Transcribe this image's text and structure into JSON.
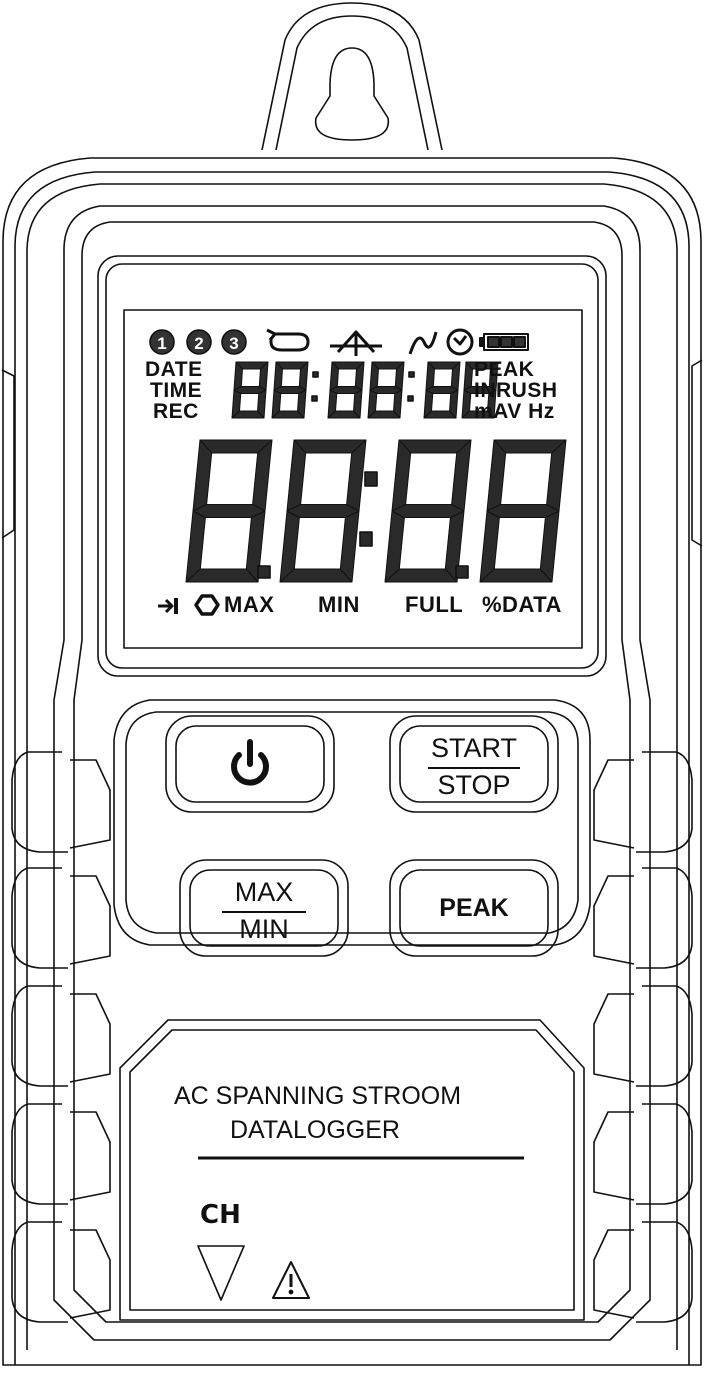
{
  "lcd": {
    "channels": [
      "1",
      "2",
      "3"
    ],
    "left_labels": {
      "date": "DATE",
      "time": "TIME",
      "rec": "REC"
    },
    "right_labels": {
      "peak": "PEAK",
      "inrush": "INRUSH",
      "units": "mAV Hz"
    },
    "small_readout": "88:88:88",
    "main_readout": "8.8:8.8",
    "bottom": {
      "max": "MAX",
      "min": "MIN",
      "full": "FULL",
      "data": "%DATA"
    },
    "icons": [
      "channel-1-icon",
      "channel-2-icon",
      "channel-3-icon",
      "loop-icon",
      "peak-hold-icon",
      "sine-wave-icon",
      "clock-icon",
      "battery-icon",
      "arrow-right-icon",
      "hexagon-icon"
    ]
  },
  "buttons": {
    "power": {
      "icon": "power-icon"
    },
    "start_stop": {
      "top": "START",
      "bottom": "STOP"
    },
    "max_min": {
      "top": "MAX",
      "bottom": "MIN"
    },
    "peak": {
      "label": "PEAK"
    }
  },
  "label_panel": {
    "line1": "AC SPANNING STROOM",
    "line2": "DATALOGGER",
    "channel": "CH",
    "icons": [
      "down-triangle-icon",
      "warning-icon"
    ]
  }
}
